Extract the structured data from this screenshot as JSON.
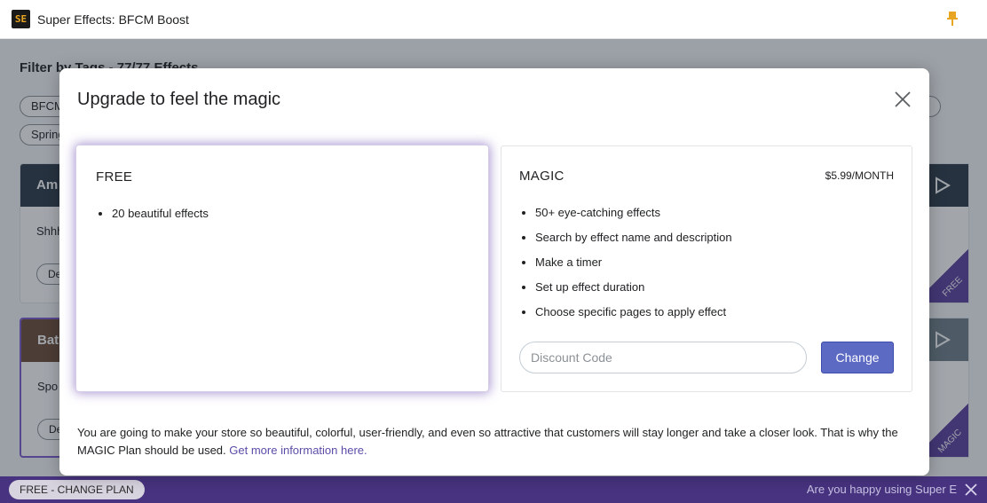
{
  "window": {
    "title": "Super Effects: BFCM Boost",
    "logo_text": "SE"
  },
  "background": {
    "filter_title": "Filter by Tags - 77/77 Effects",
    "tags": [
      "BFCM",
      "Spring"
    ],
    "cards": [
      {
        "title": "Am",
        "desc": "Shhh",
        "button": "De"
      },
      {
        "title": "Bat",
        "desc": "Spo",
        "button": "De"
      }
    ],
    "ribbons": [
      "FREE",
      "MAGIC"
    ]
  },
  "modal": {
    "title": "Upgrade to feel the magic",
    "free_plan": {
      "name": "FREE",
      "features": [
        "20 beautiful effects"
      ]
    },
    "magic_plan": {
      "name": "MAGIC",
      "price": "$5.99/MONTH",
      "features": [
        "50+ eye-catching effects",
        "Search by effect name and description",
        "Make a timer",
        "Set up effect duration",
        "Choose specific pages to apply effect"
      ],
      "discount_placeholder": "Discount Code",
      "discount_value": "",
      "change_label": "Change"
    },
    "footer_text": "You are going to make your store so beautiful, colorful, user-friendly, and even so attractive that customers will stay longer and take a closer look. That is why the MAGIC Plan should be used.",
    "footer_link": "Get more information here."
  },
  "bottom_bar": {
    "plan_label": "FREE - CHANGE PLAN",
    "happy_text": "Are you happy using Super E"
  },
  "colors": {
    "accent": "#5c6ac4",
    "brand_purple": "#47337f",
    "free_glow": "#5e3eaa"
  },
  "icons": {
    "pin": "pin-icon",
    "close": "close-icon",
    "play": "play-icon"
  }
}
